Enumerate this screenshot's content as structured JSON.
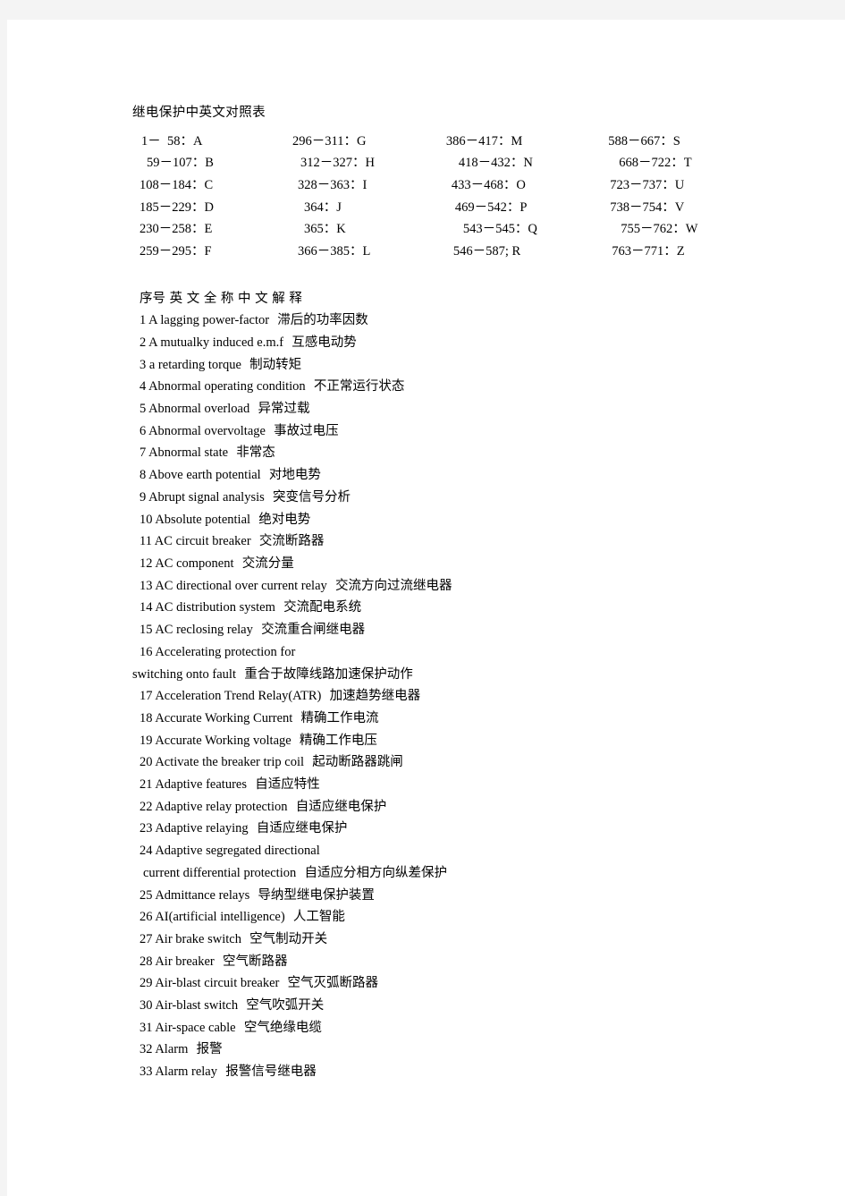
{
  "document": {
    "title": "继电保护中英文对照表"
  },
  "letter_index": {
    "rows": [
      {
        "a": "1－  58：A",
        "b": "296－311：G",
        "c": "386－417：M",
        "d": "588－667：S"
      },
      {
        "a": "59－107：B",
        "b": "312－327：H",
        "c": "418－432：N",
        "d": "668－722：T"
      },
      {
        "a": "108－184：C",
        "b": "328－363：I",
        "c": "433－468：O",
        "d": "723－737：U"
      },
      {
        "a": "185－229：D",
        "b": "364：J",
        "c": "469－542：P",
        "d": "738－754：V"
      },
      {
        "a": "230－258：E",
        "b": "365：K",
        "c": "543－545：Q",
        "d": "755－762：W"
      },
      {
        "a": "259－295：F",
        "b": "366－385：L",
        "c": "546－587; R",
        "d": "763－771：Z"
      }
    ]
  },
  "glossary": {
    "header": "序号 英 文 全 称 中 文 解 释",
    "entries": [
      {
        "num": "1",
        "en": "A lagging power-factor",
        "cn": "滞后的功率因数"
      },
      {
        "num": "2",
        "en": "A mutualky induced e.m.f",
        "cn": "互感电动势"
      },
      {
        "num": "3",
        "en": "a retarding torque",
        "cn": "制动转矩"
      },
      {
        "num": "4",
        "en": "Abnormal operating condition",
        "cn": "不正常运行状态"
      },
      {
        "num": "5",
        "en": "Abnormal overload",
        "cn": "异常过载"
      },
      {
        "num": "6",
        "en": "Abnormal overvoltage",
        "cn": "事故过电压"
      },
      {
        "num": "7",
        "en": "Abnormal state",
        "cn": "非常态"
      },
      {
        "num": "8",
        "en": "Above earth potential",
        "cn": "对地电势"
      },
      {
        "num": "9",
        "en": "Abrupt signal analysis",
        "cn": "突变信号分析"
      },
      {
        "num": "10",
        "en": "Absolute potential",
        "cn": "绝对电势"
      },
      {
        "num": "11",
        "en": "AC circuit breaker",
        "cn": "交流断路器"
      },
      {
        "num": "12",
        "en": "AC component",
        "cn": "交流分量"
      },
      {
        "num": "13",
        "en": "AC directional over current relay",
        "cn": "交流方向过流继电器"
      },
      {
        "num": "14",
        "en": "AC distribution system",
        "cn": "交流配电系统"
      },
      {
        "num": "15",
        "en": "AC reclosing relay",
        "cn": "交流重合闸继电器"
      },
      {
        "num": "16",
        "en": "Accelerating protection for",
        "cn": "",
        "cont": {
          "en": "switching onto fault",
          "cn": "重合于故障线路加速保护动作",
          "indent": false
        }
      },
      {
        "num": "17",
        "en": "Acceleration Trend Relay(ATR)",
        "cn": "加速趋势继电器"
      },
      {
        "num": "18",
        "en": "Accurate Working Current",
        "cn": "精确工作电流"
      },
      {
        "num": "19",
        "en": "Accurate Working voltage",
        "cn": "精确工作电压"
      },
      {
        "num": "20",
        "en": "Activate the breaker trip coil",
        "cn": "起动断路器跳闸"
      },
      {
        "num": "21",
        "en": "Adaptive features",
        "cn": "自适应特性"
      },
      {
        "num": "22",
        "en": "Adaptive relay protection",
        "cn": "自适应继电保护"
      },
      {
        "num": "23",
        "en": "Adaptive relaying",
        "cn": "自适应继电保护"
      },
      {
        "num": "24",
        "en": "Adaptive segregated directional",
        "cn": "",
        "cont": {
          "en": "current differential protection",
          "cn": "自适应分相方向纵差保护",
          "indent": true
        }
      },
      {
        "num": "25",
        "en": "Admittance relays",
        "cn": "导纳型继电保护装置"
      },
      {
        "num": "26",
        "en": "AI(artificial intelligence)",
        "cn": "人工智能"
      },
      {
        "num": "27",
        "en": "Air brake switch",
        "cn": "空气制动开关"
      },
      {
        "num": "28",
        "en": "Air breaker",
        "cn": "空气断路器"
      },
      {
        "num": "29",
        "en": "Air-blast circuit breaker",
        "cn": "空气灭弧断路器"
      },
      {
        "num": "30",
        "en": "Air-blast switch",
        "cn": "空气吹弧开关"
      },
      {
        "num": "31",
        "en": "Air-space cable",
        "cn": "空气绝缘电缆"
      },
      {
        "num": "32",
        "en": "Alarm",
        "cn": "报警"
      },
      {
        "num": "33",
        "en": "Alarm relay",
        "cn": "报警信号继电器"
      }
    ]
  },
  "colors": {
    "canvas": "#f4f4f4",
    "page": "#ffffff",
    "text": "#000000"
  }
}
